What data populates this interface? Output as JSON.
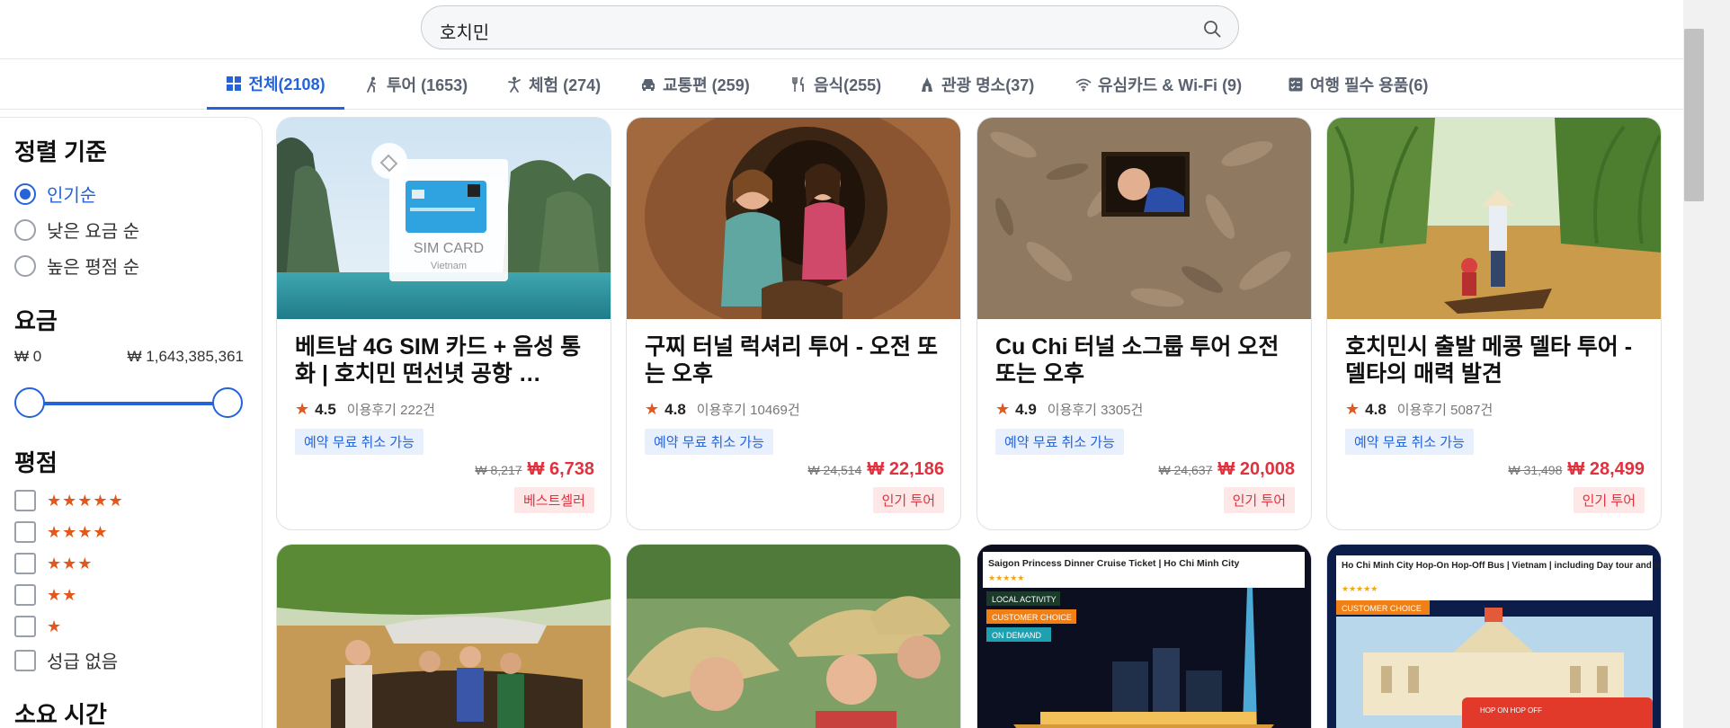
{
  "search": {
    "query": "호치민"
  },
  "tabs": [
    {
      "label": "전체(2108)",
      "icon": "grid-icon",
      "active": true
    },
    {
      "label": "투어 (1653)",
      "icon": "walking-person-icon",
      "active": false
    },
    {
      "label": "체험 (274)",
      "icon": "activity-person-icon",
      "active": false
    },
    {
      "label": "교통편 (259)",
      "icon": "car-icon",
      "active": false
    },
    {
      "label": "음식(255)",
      "icon": "utensils-icon",
      "active": false
    },
    {
      "label": "관광 명소(37)",
      "icon": "landmark-icon",
      "active": false
    },
    {
      "label": "유심카드 & Wi-Fi (9)",
      "icon": "wifi-icon",
      "active": false
    },
    {
      "label": "여행 필수 용품(6)",
      "icon": "checklist-icon",
      "active": false
    }
  ],
  "sidebar": {
    "sort_title": "정렬 기준",
    "sort_options": [
      {
        "label": "인기순",
        "selected": true
      },
      {
        "label": "낮은 요금 순",
        "selected": false
      },
      {
        "label": "높은 평점 순",
        "selected": false
      }
    ],
    "price_title": "요금",
    "price_min": "₩ 0",
    "price_max": "₩ 1,643,385,361",
    "rating_title": "평점",
    "rating_options": [
      {
        "stars": "★★★★★"
      },
      {
        "stars": "★★★★"
      },
      {
        "stars": "★★★"
      },
      {
        "stars": "★★"
      },
      {
        "stars": "★"
      },
      {
        "label": "성급 없음"
      }
    ],
    "duration_title": "소요 시간"
  },
  "products": [
    {
      "title": "베트남 4G SIM 카드 + 음성 통화 | 호치민 떤선녓 공항 …",
      "rating": "4.5",
      "reviews": "이용후기 222건",
      "free_cancel": "예약 무료 취소 가능",
      "orig_price": "₩ 8,217",
      "sale_price": "₩ 6,738",
      "badge": "베스트셀러",
      "image_text": [
        "SIM CARD",
        "Vietnam"
      ]
    },
    {
      "title": "구찌 터널 럭셔리 투어 - 오전 또는 오후",
      "rating": "4.8",
      "reviews": "이용후기 10469건",
      "free_cancel": "예약 무료 취소 가능",
      "orig_price": "₩ 24,514",
      "sale_price": "₩ 22,186",
      "badge": "인기 투어"
    },
    {
      "title": "Cu Chi 터널 소그룹 투어 오전 또는 오후",
      "rating": "4.9",
      "reviews": "이용후기 3305건",
      "free_cancel": "예약 무료 취소 가능",
      "orig_price": "₩ 24,637",
      "sale_price": "₩ 20,008",
      "badge": "인기 투어"
    },
    {
      "title": "호치민시 출발 메콩 델타 투어 - 델타의 매력 발견",
      "rating": "4.8",
      "reviews": "이용후기 5087건",
      "free_cancel": "예약 무료 취소 가능",
      "orig_price": "₩ 31,498",
      "sale_price": "₩ 28,499",
      "badge": "인기 투어"
    }
  ],
  "second_row": [
    {
      "image_text": []
    },
    {
      "image_text": []
    },
    {
      "image_text": [
        "Saigon Princess Dinner Cruise Ticket | Ho Chi Minh City",
        "★★★★★",
        "LOCAL ACTIVITY",
        "CUSTOMER CHOICE",
        "ON DEMAND"
      ]
    },
    {
      "image_text": [
        "Ho Chi Minh City Hop-On Hop-Off Bus | Vietnam | including Day tour and Night tour)",
        "★★★★★",
        "CUSTOMER CHOICE",
        "HOP ON HOP OFF"
      ]
    }
  ],
  "colors": {
    "accent": "#2563d9",
    "price_red": "#e0313f",
    "star_orange": "#e2571b"
  }
}
